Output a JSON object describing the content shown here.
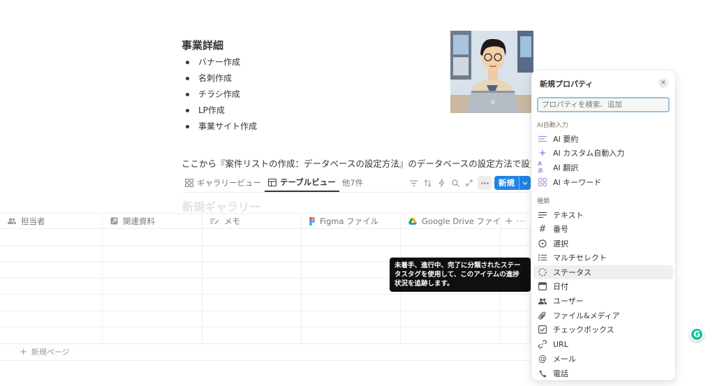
{
  "page": {
    "heading": "事業詳細",
    "bullets": [
      "バナー作成",
      "名刺作成",
      "チラシ作成",
      "LP作成",
      "事業サイト作成"
    ],
    "paragraph": "ここから『案件リストの作成：データベースの設定方法』のデータベースの設定方法で設定します"
  },
  "views": {
    "tabs": [
      {
        "label": "ギャラリービュー",
        "icon": "gallery-icon"
      },
      {
        "label": "テーブルビュー",
        "icon": "table-icon"
      }
    ],
    "more_label": "他7件",
    "new_label": "新規"
  },
  "gallery_title": "新規ギャラリー",
  "table": {
    "columns": [
      {
        "label": "担当者",
        "icon": "people-icon"
      },
      {
        "label": "関連資料",
        "icon": "relation-icon"
      },
      {
        "label": "メモ",
        "icon": "text-icon"
      },
      {
        "label": "Figma ファイル",
        "icon": "figma-icon"
      },
      {
        "label": "Google Drive ファイル",
        "icon": "google-drive-icon"
      }
    ],
    "add_page_label": "新規ページ"
  },
  "tooltip": "未着手、進行中、完了に分類されたステータスタグを使用して、このアイテムの進捗状況を追跡します。",
  "panel": {
    "title": "新規プロパティ",
    "search_placeholder": "プロパティを検索、追加",
    "ai_section": "AI自動入力",
    "ai_items": [
      {
        "label": "AI 要約",
        "icon": "ai-summary-icon"
      },
      {
        "label": "AI カスタム自動入力",
        "icon": "ai-sparkle-icon"
      },
      {
        "label": "AI 翻訳",
        "icon": "ai-translate-icon"
      },
      {
        "label": "AI キーワード",
        "icon": "ai-keywords-icon"
      }
    ],
    "type_section": "種類",
    "type_items": [
      {
        "label": "テキスト",
        "icon": "text-lines-icon"
      },
      {
        "label": "番号",
        "icon": "hash-icon"
      },
      {
        "label": "選択",
        "icon": "select-icon"
      },
      {
        "label": "マルチセレクト",
        "icon": "list-icon"
      },
      {
        "label": "ステータス",
        "icon": "status-icon"
      },
      {
        "label": "日付",
        "icon": "calendar-icon"
      },
      {
        "label": "ユーザー",
        "icon": "people-icon"
      },
      {
        "label": "ファイル&メディア",
        "icon": "paperclip-icon"
      },
      {
        "label": "チェックボックス",
        "icon": "checkbox-icon"
      },
      {
        "label": "URL",
        "icon": "link-icon"
      },
      {
        "label": "メール",
        "icon": "at-icon"
      },
      {
        "label": "電話",
        "icon": "phone-icon"
      }
    ]
  }
}
